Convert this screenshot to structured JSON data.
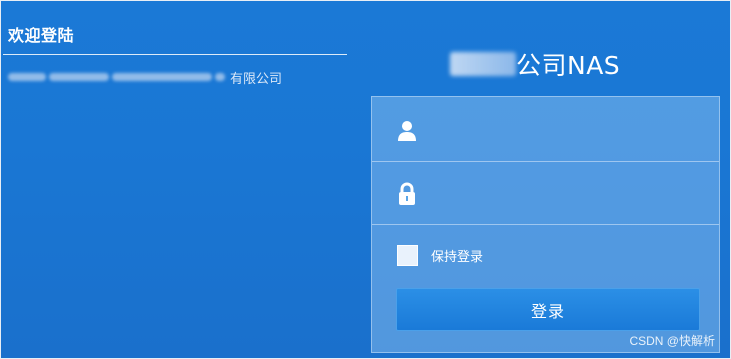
{
  "header": {
    "welcome_title": "欢迎登陆",
    "company_name_suffix": "有限公司"
  },
  "brand": {
    "name_visible": "公司NAS"
  },
  "login_form": {
    "username_icon": "user-icon",
    "password_icon": "lock-icon",
    "remember_label": "保持登录",
    "remember_checked": false,
    "submit_label": "登录"
  },
  "watermark": {
    "text": "CSDN @快解析"
  },
  "colors": {
    "background": "#1a77d4",
    "button": "#1f82dd",
    "panel": "#8fc3f0"
  }
}
